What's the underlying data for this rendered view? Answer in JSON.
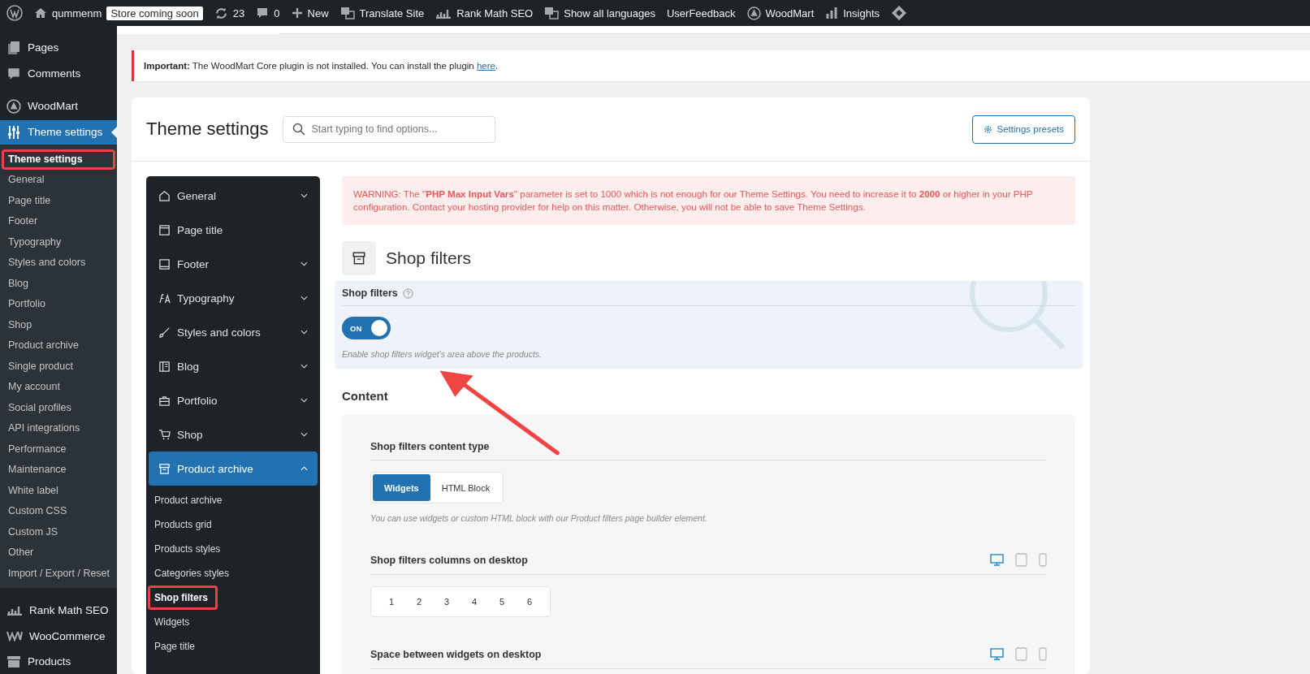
{
  "admin_bar": {
    "items": [
      {
        "kind": "wp"
      },
      {
        "kind": "home",
        "label": "qummenm"
      },
      {
        "kind": "badge",
        "label": "Store coming soon"
      },
      {
        "kind": "updates",
        "label": "23"
      },
      {
        "kind": "comments",
        "label": "0"
      },
      {
        "kind": "new",
        "label": "New"
      },
      {
        "kind": "translate",
        "label": "Translate Site"
      },
      {
        "kind": "chart",
        "label": "Rank Math SEO"
      },
      {
        "kind": "translate",
        "label": "Show all languages"
      },
      {
        "kind": "text",
        "label": "UserFeedback"
      },
      {
        "kind": "woodmart",
        "label": "WoodMart"
      },
      {
        "kind": "bars",
        "label": "Insights"
      },
      {
        "kind": "diamond"
      }
    ]
  },
  "sidebar": {
    "top": [
      {
        "kind": "pages",
        "label": "Pages",
        "selected": false
      },
      {
        "kind": "comments",
        "label": "Comments",
        "selected": false
      },
      {
        "kind": "woodmart",
        "label": "WoodMart",
        "selected": false
      },
      {
        "kind": "sliders",
        "label": "Theme settings",
        "selected": true
      }
    ],
    "submenu": [
      {
        "label": "Theme settings",
        "selected": true,
        "highlighted": true
      },
      {
        "label": "General",
        "selected": false,
        "highlighted": false
      },
      {
        "label": "Page title",
        "selected": false,
        "highlighted": false
      },
      {
        "label": "Footer",
        "selected": false,
        "highlighted": false
      },
      {
        "label": "Typography",
        "selected": false,
        "highlighted": false
      },
      {
        "label": "Styles and colors",
        "selected": false,
        "highlighted": false
      },
      {
        "label": "Blog",
        "selected": false,
        "highlighted": false
      },
      {
        "label": "Portfolio",
        "selected": false,
        "highlighted": false
      },
      {
        "label": "Shop",
        "selected": false,
        "highlighted": false
      },
      {
        "label": "Product archive",
        "selected": false,
        "highlighted": false
      },
      {
        "label": "Single product",
        "selected": false,
        "highlighted": false
      },
      {
        "label": "My account",
        "selected": false,
        "highlighted": false
      },
      {
        "label": "Social profiles",
        "selected": false,
        "highlighted": false
      },
      {
        "label": "API integrations",
        "selected": false,
        "highlighted": false
      },
      {
        "label": "Performance",
        "selected": false,
        "highlighted": false
      },
      {
        "label": "Maintenance",
        "selected": false,
        "highlighted": false
      },
      {
        "label": "White label",
        "selected": false,
        "highlighted": false
      },
      {
        "label": "Custom CSS",
        "selected": false,
        "highlighted": false
      },
      {
        "label": "Custom JS",
        "selected": false,
        "highlighted": false
      },
      {
        "label": "Other",
        "selected": false,
        "highlighted": false
      },
      {
        "label": "Import / Export / Reset",
        "selected": false,
        "highlighted": false
      }
    ],
    "bottom": [
      {
        "kind": "chart",
        "label": "Rank Math SEO",
        "selected": false
      },
      {
        "kind": "woo",
        "label": "WooCommerce",
        "selected": false
      },
      {
        "kind": "archive",
        "label": "Products",
        "selected": false
      }
    ]
  },
  "notice": {
    "text": "**Important:** The WoodMart Core plugin is not installed. You can install the plugin ",
    "link": "here",
    "end": "."
  },
  "header": {
    "title": "Theme settings",
    "search": {
      "placeholder": "Start typing to find options..."
    },
    "presets_button": "Settings presets"
  },
  "nav": {
    "items": [
      {
        "kind": "home",
        "label": "General",
        "selected": false,
        "expanded": false
      },
      {
        "kind": "page",
        "label": "Page title",
        "selected": false
      },
      {
        "kind": "book",
        "label": "Footer",
        "selected": false,
        "expanded": false
      },
      {
        "kind": "type",
        "label": "Typography",
        "selected": false,
        "expanded": false
      },
      {
        "kind": "brush",
        "label": "Styles and colors",
        "selected": false,
        "expanded": false
      },
      {
        "kind": "blog",
        "label": "Blog",
        "selected": false,
        "expanded": false
      },
      {
        "kind": "case",
        "label": "Portfolio",
        "selected": false,
        "expanded": false
      },
      {
        "kind": "cart",
        "label": "Shop",
        "selected": false,
        "expanded": false
      },
      {
        "kind": "archive",
        "label": "Product archive",
        "selected": true,
        "expanded": true,
        "children": [
          {
            "label": "Product archive",
            "selected": false,
            "highlighted": false
          },
          {
            "label": "Products grid",
            "selected": false,
            "highlighted": false
          },
          {
            "label": "Products styles",
            "selected": false,
            "highlighted": false
          },
          {
            "label": "Categories styles",
            "selected": false,
            "highlighted": false
          },
          {
            "label": "Shop filters",
            "selected": true,
            "highlighted": true
          },
          {
            "label": "Widgets",
            "selected": false,
            "highlighted": false
          },
          {
            "label": "Page title",
            "selected": false,
            "highlighted": false
          }
        ]
      }
    ]
  },
  "warning": "WARNING: The \"**PHP Max Input Vars**\" parameter is set to 1000 which is not enough for our Theme Settings. You need to increase it to **2000** or higher in your PHP configuration. Contact your hosting provider for help on this matter. Otherwise, you will not be able to save Theme Settings.",
  "section": {
    "title": "Shop filters"
  },
  "highlighted_option": {
    "label": "Shop filters",
    "on": true,
    "switch_label": "ON",
    "description": "Enable shop filters widget's area above the products."
  },
  "content": {
    "title": "Content",
    "content_type": {
      "label": "Shop filters content type",
      "options": [
        {
          "label": "Widgets",
          "selected": true
        },
        {
          "label": "HTML Block",
          "selected": false
        }
      ],
      "description": "You can use widgets or custom HTML block with our Product filters page builder element."
    },
    "columns": {
      "label": "Shop filters columns on desktop",
      "devices": [
        {
          "kind": "desktop",
          "selected": true
        },
        {
          "kind": "tablet",
          "selected": false
        },
        {
          "kind": "phone",
          "selected": false
        }
      ],
      "options": [
        {
          "label": "1",
          "selected": false
        },
        {
          "label": "2",
          "selected": false
        },
        {
          "label": "3",
          "selected": false
        },
        {
          "label": "4",
          "selected": false
        },
        {
          "label": "5",
          "selected": false
        },
        {
          "label": "6",
          "selected": false
        }
      ]
    },
    "spacing": {
      "label": "Space between widgets on desktop",
      "devices": [
        {
          "kind": "desktop",
          "selected": true
        },
        {
          "kind": "tablet",
          "selected": false
        },
        {
          "kind": "phone",
          "selected": false
        }
      ]
    }
  }
}
